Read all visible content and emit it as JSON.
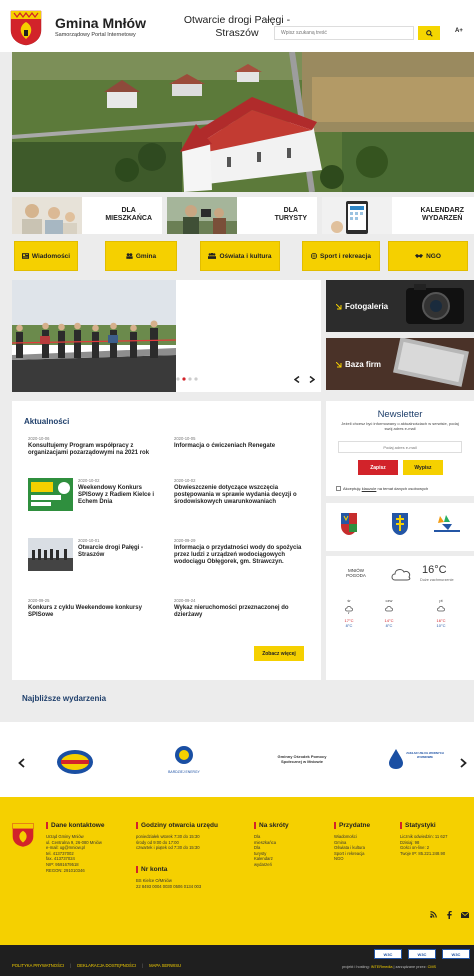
{
  "header": {
    "title": "Gmina Mnłów",
    "subtitle": "Samorządowy Portal Internetowy",
    "search_placeholder": "Wpisz szukaną treść",
    "font_size_label": "A+"
  },
  "audience": [
    {
      "label": "DLA\nMIESZKAŃCA"
    },
    {
      "label": "DLA\nTURYSTY"
    },
    {
      "label": "KALENDARZ\nWYDARZEŃ"
    }
  ],
  "nav": [
    {
      "label": "Wiadomości",
      "icon": "newspaper-icon"
    },
    {
      "label": "Gmina",
      "icon": "people-icon"
    },
    {
      "label": "Oświata i kultura",
      "icon": "group-icon"
    },
    {
      "label": "Sport i rekreacja",
      "icon": "ball-icon"
    },
    {
      "label": "NGO",
      "icon": "handshake-icon"
    }
  ],
  "slider": {
    "title": "Otwarcie drogi Pałęgi - Straszów"
  },
  "side_tiles": [
    {
      "label": "Fotogaleria"
    },
    {
      "label": "Baza firm"
    }
  ],
  "news": {
    "title": "Aktualności",
    "items": [
      {
        "date": "2020-10-06",
        "title": "Konsultujemy Program współpracy z organizacjami pozarządowymi na 2021 rok"
      },
      {
        "date": "2020-10-05",
        "title": "Informacja o ćwiczeniach Renegate"
      },
      {
        "date": "2020-10-02",
        "title": "Weekendowy Konkurs SPISowy z Radiem Kielce i Echem Dnia"
      },
      {
        "date": "2020-10-02",
        "title": "Obwieszczenie dotyczące wszczęcia postępowania w sprawie wydania decyzji o środowiskowych uwarunkowaniach"
      },
      {
        "date": "2020-10-01",
        "title": "Otwarcie drogi Pałęgi - Straszów"
      },
      {
        "date": "2020-09-29",
        "title": "Informacja o przydatności wody do spożycia przez ludzi z urządzeń wodociągowych wodociągu Obłęgorek, gm. Strawczyn."
      },
      {
        "date": "2020-09-25",
        "title": "Konkurs z cyklu Weekendowe konkursy SPISowe"
      },
      {
        "date": "2020-09-24",
        "title": "Wykaz nieruchomości przeznaczonej do dzierżawy"
      }
    ],
    "more_label": "Zobacz więcej"
  },
  "newsletter": {
    "title": "Newsletter",
    "desc": "Jeżeli chcesz być informowany o aktualnościach w serwisie, podaj swój adres e-mail",
    "email_placeholder": "Podaj adres e-mail",
    "subscribe_label": "Zapisz",
    "unsubscribe_label": "Wypisz",
    "consent_pre": "Akceptuję ",
    "consent_link": "klauzule",
    "consent_post": " na temat danych osobowych"
  },
  "weather": {
    "city": "MNIÓW",
    "label": "POGODA",
    "temp": "16°C",
    "desc": "Duże zachmurzenie",
    "days": [
      {
        "name": "śr",
        "hi": "17°C",
        "lo": "8°C"
      },
      {
        "name": "czw",
        "hi": "14°C",
        "lo": "8°C"
      },
      {
        "name": "pt",
        "hi": "16°C",
        "lo": "10°C"
      }
    ]
  },
  "events": {
    "title": "Najbliższe wydarzenia"
  },
  "partners": {
    "center_text": "Gminny Ośrodek Pomocy\nSpołecznej w Mniowie",
    "logo2_text": "BARDZIEJ ENERGY",
    "logo4_text": "ZAKŁAD USŁUG WODNYCH W MNIOWIE"
  },
  "footer": {
    "contact": {
      "heading": "Dane kontaktowe",
      "lines": [
        "Urząd Gminy Mniów",
        "ul. Centralna 9, 26-080 Mniów",
        "e-mail: ug@mniow.pl",
        "tel. 413737002",
        "fax. 413737024",
        "NIP: 9591679518",
        "REGON: 291010346"
      ]
    },
    "hours": {
      "heading": "Godziny otwarcia urzędu",
      "lines": [
        "poniedziałek wtorek 7:30 do 15:30",
        "środy od 9:00 do 17:00",
        "czwartek i piątek od 7:30 do 15:30"
      ]
    },
    "account": {
      "heading": "Nr konta",
      "lines": [
        "BS Kielce O/Mniów",
        "22 8493 0004 0030 0506 0134 003"
      ]
    },
    "shortcuts": {
      "heading": "Na skróty",
      "lines": [
        "Dla",
        "mieszkańca",
        "Dla",
        "turysty",
        "Kalendarz",
        "wydarzeń"
      ]
    },
    "useful": {
      "heading": "Przydatne",
      "lines": [
        "Wiadomości",
        "Gmina",
        "Oświata i kultura",
        "Sport i rekreacja",
        "NGO"
      ]
    },
    "stats": {
      "heading": "Statystyki",
      "lines": [
        "Licznik odwiedzin: 11 627",
        "Dzisiaj: 98",
        "Gości on-line: 2",
        "Twoje IP: 85.221.248.90"
      ]
    }
  },
  "bottom": {
    "links": [
      "POLITYKA PRYWATNOŚCI",
      "DEKLARACJA DOSTĘPNOŚCI",
      "MAPA SERWISU"
    ],
    "credit_pre": "projekt i hosting: ",
    "credit_brand": "INTERmedia",
    "credit_mid": " | zarządzane przez: ",
    "credit_cms": "CMS",
    "badge_labels": [
      "W3C",
      "W3C",
      "W3C"
    ]
  }
}
